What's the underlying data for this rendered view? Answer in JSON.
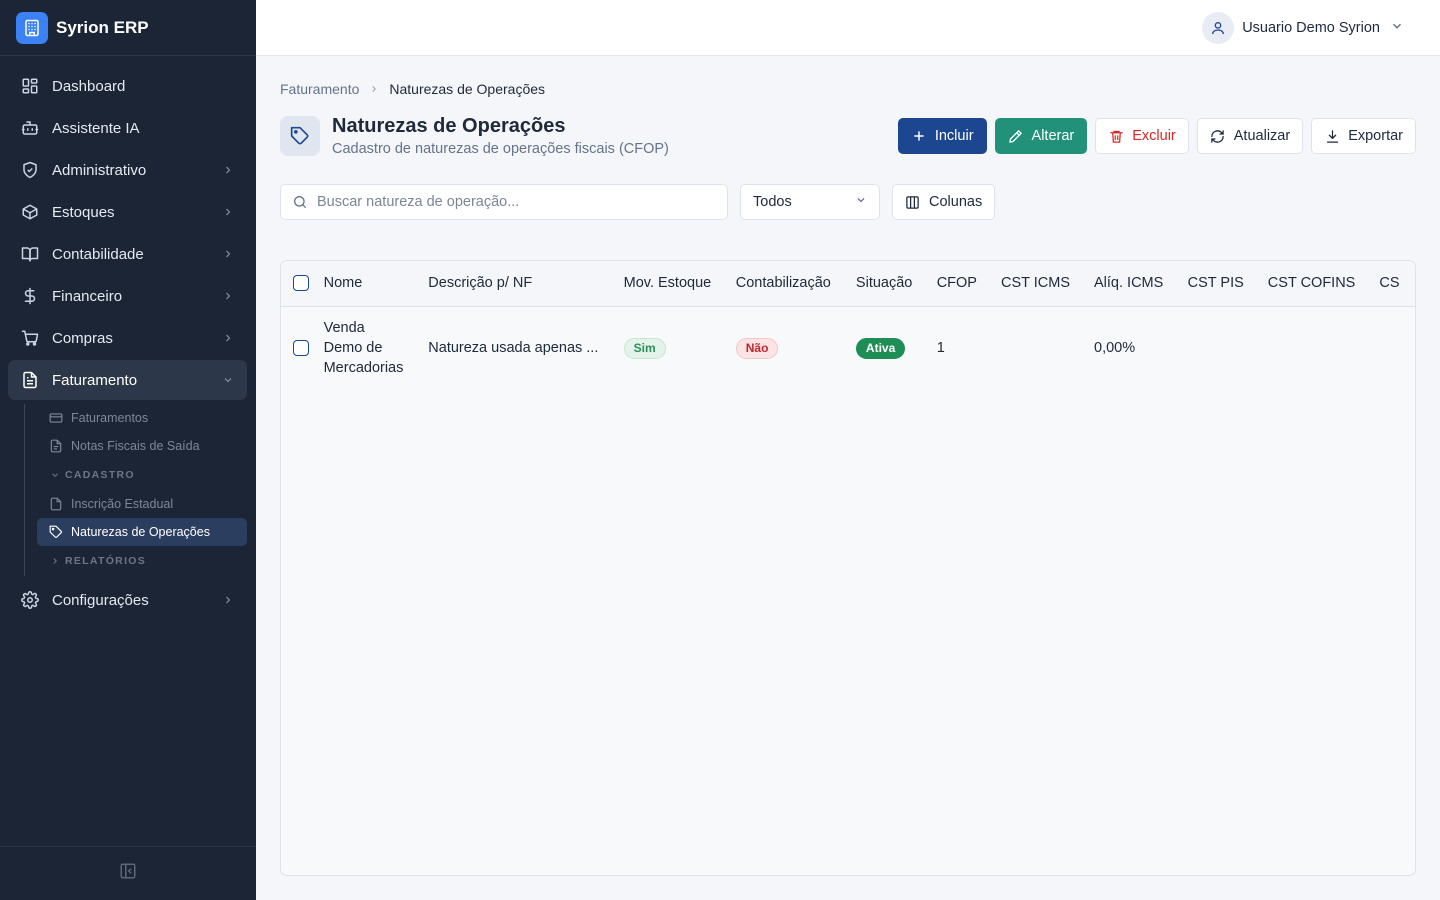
{
  "app": {
    "name": "Syrion ERP"
  },
  "sidebar": {
    "items": [
      {
        "label": "Dashboard",
        "icon": "dashboard-icon"
      },
      {
        "label": "Assistente IA",
        "icon": "bot-icon"
      },
      {
        "label": "Administrativo",
        "icon": "shield-icon"
      },
      {
        "label": "Estoques",
        "icon": "box-icon"
      },
      {
        "label": "Contabilidade",
        "icon": "book-icon"
      },
      {
        "label": "Financeiro",
        "icon": "dollar-icon"
      },
      {
        "label": "Compras",
        "icon": "cart-icon"
      },
      {
        "label": "Faturamento",
        "icon": "file-text-icon"
      },
      {
        "label": "Configurações",
        "icon": "gear-icon"
      }
    ],
    "faturamento_sub": {
      "items": [
        {
          "label": "Faturamentos"
        },
        {
          "label": "Notas Fiscais de Saída"
        }
      ],
      "group_cadastro": "CADASTRO",
      "cadastro_items": [
        {
          "label": "Inscrição Estadual"
        },
        {
          "label": "Naturezas de Operações"
        }
      ],
      "group_relatorios": "RELATÓRIOS"
    }
  },
  "topbar": {
    "user_name": "Usuario Demo Syrion"
  },
  "breadcrumb": {
    "parent": "Faturamento",
    "current": "Naturezas de Operações"
  },
  "page": {
    "title": "Naturezas de Operações",
    "subtitle": "Cadastro de naturezas de operações fiscais (CFOP)"
  },
  "actions": {
    "incluir": "Incluir",
    "alterar": "Alterar",
    "excluir": "Excluir",
    "atualizar": "Atualizar",
    "exportar": "Exportar"
  },
  "filters": {
    "search_placeholder": "Buscar natureza de operação...",
    "search_value": "",
    "status_selected": "Todos",
    "columns_label": "Colunas"
  },
  "table": {
    "columns": [
      "Nome",
      "Descrição p/ NF",
      "Mov. Estoque",
      "Contabilização",
      "Situação",
      "CFOP",
      "CST ICMS",
      "Alíq. ICMS",
      "CST PIS",
      "CST COFINS",
      "CS"
    ],
    "rows": [
      {
        "nome": "Venda Demo de Mercadorias",
        "descricao": "Natureza usada apenas ...",
        "mov_estoque": "Sim",
        "contabilizacao": "Não",
        "situacao": "Ativa",
        "cfop": "1",
        "cst_icms": "",
        "aliq_icms": "0,00%",
        "cst_pis": "",
        "cst_cofins": "",
        "cs": ""
      }
    ]
  },
  "colors": {
    "sidebar_bg": "#1b2536",
    "primary": "#1d4690",
    "success": "#22917a",
    "danger": "#dc2626",
    "brand": "#3b82f6"
  }
}
